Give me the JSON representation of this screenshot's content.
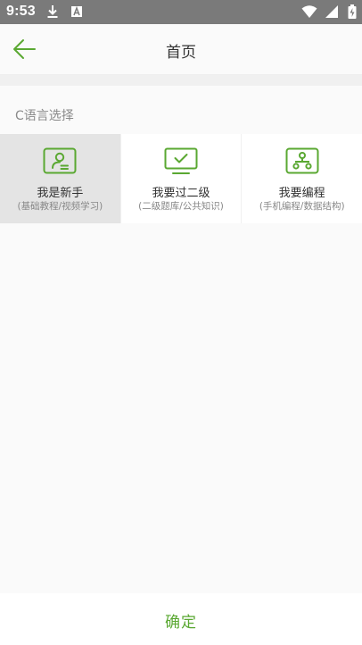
{
  "status_bar": {
    "time": "9:53"
  },
  "header": {
    "title": "首页"
  },
  "section": {
    "label": "C语言选择"
  },
  "options": [
    {
      "title": "我是新手",
      "subtitle": "(基础教程/视频学习)",
      "icon": "id-card-icon",
      "selected": true
    },
    {
      "title": "我要过二级",
      "subtitle": "(二级题库/公共知识)",
      "icon": "monitor-check-icon",
      "selected": false
    },
    {
      "title": "我要编程",
      "subtitle": "(手机编程/数据结构)",
      "icon": "network-icon",
      "selected": false
    }
  ],
  "confirm": {
    "label": "确定"
  },
  "colors": {
    "accent": "#5aa832",
    "status_bar": "#7a7a7a",
    "selected_bg": "#e4e4e4"
  }
}
